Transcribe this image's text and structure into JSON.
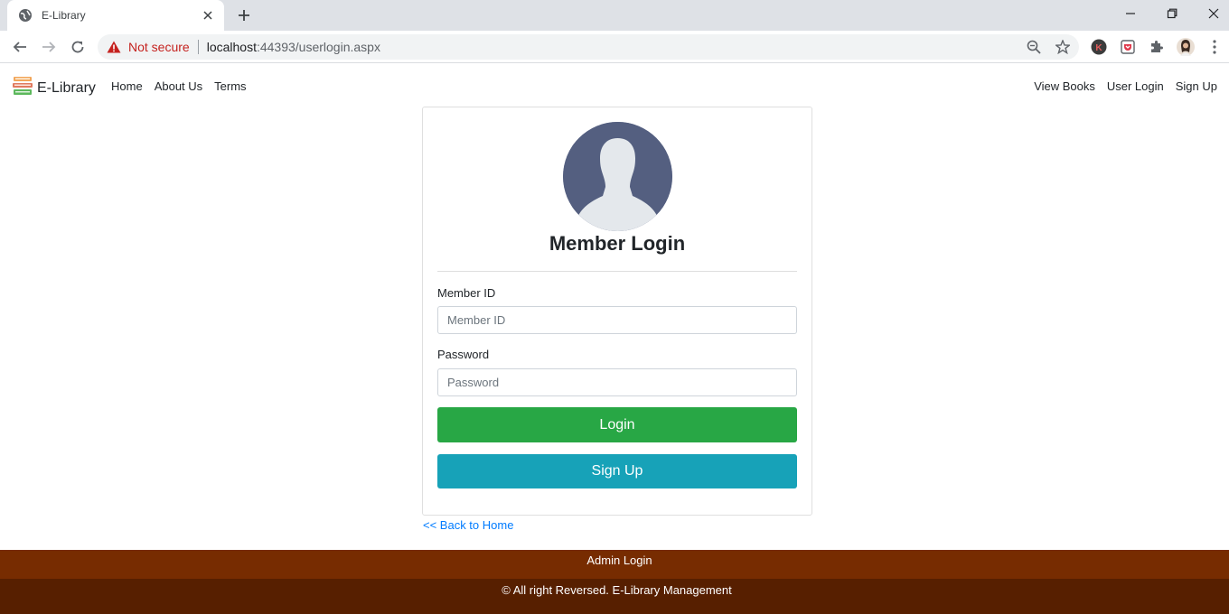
{
  "browser": {
    "tab_title": "E-Library",
    "security_label": "Not secure",
    "url_host": "localhost",
    "url_path": ":44393/userlogin.aspx"
  },
  "site": {
    "brand": "E-Library",
    "nav_left": [
      "Home",
      "About Us",
      "Terms"
    ],
    "nav_right": [
      "View Books",
      "User Login",
      "Sign Up"
    ]
  },
  "login": {
    "title": "Member Login",
    "member_id_label": "Member ID",
    "member_id_placeholder": "Member ID",
    "password_label": "Password",
    "password_placeholder": "Password",
    "login_button": "Login",
    "signup_button": "Sign Up",
    "back_link": "<< Back to Home"
  },
  "footer": {
    "admin_login": "Admin Login",
    "copyright": "© All right Reversed. E-Library Management"
  },
  "colors": {
    "login_button": "#28a745",
    "signup_button": "#17a2b8",
    "footer_top": "#772c01",
    "footer_bottom": "#571f00",
    "link": "#007bff",
    "not_secure": "#c5221f"
  }
}
